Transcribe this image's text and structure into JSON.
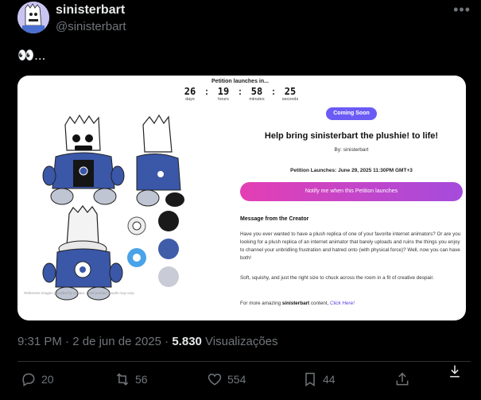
{
  "author": {
    "name": "sinisterbart",
    "handle": "@sinisterbart"
  },
  "more_label": "•••",
  "tweet_text": "👀...",
  "card": {
    "countdown": {
      "title": "Petition launches in...",
      "units": [
        {
          "value": "26",
          "label": "days"
        },
        {
          "value": "19",
          "label": "hours"
        },
        {
          "value": "58",
          "label": "minutes"
        },
        {
          "value": "25",
          "label": "seconds"
        }
      ]
    },
    "badge": "Coming Soon",
    "title": "Help bring sinisterbart the plushie! to life!",
    "by": "By: sinisterbart",
    "launch_date": "Petition Launches: June 29, 2025 11:30PM GMT+3",
    "notify_button": "Notify me when this Petition launches",
    "message_header": "Message from the Creator",
    "message_p1": "Have you ever wanted to have a plush replica of one of your favorite internet animators? Or are you looking for a plush replica of an internet animator that barely uploads and ruins the things you enjoy to channel your unbridling frustration and hatred onto (with physical force)? Well, now you can have both!",
    "message_p2": "Soft, squishy, and just the right size to chuck across the room in a fit of creative despair.",
    "message_p3_prefix": "For more amazing ",
    "message_p3_bold": "sinisterbart",
    "message_p3_mid": " content, ",
    "message_p3_link": "Click Here!",
    "disclaimer": "Reference images provided by creator. Final product results may vary.",
    "swatches": [
      "#1a1a1a",
      "#3f5da8",
      "#c9ccd6"
    ]
  },
  "meta": {
    "time": "9:31 PM",
    "sep1": " · ",
    "date": "2 de jun de 2025",
    "sep2": " · ",
    "views": "5.830",
    "views_label": " Visualizações"
  },
  "actions": {
    "replies": "20",
    "reposts": "56",
    "likes": "554",
    "bookmarks": "44"
  }
}
